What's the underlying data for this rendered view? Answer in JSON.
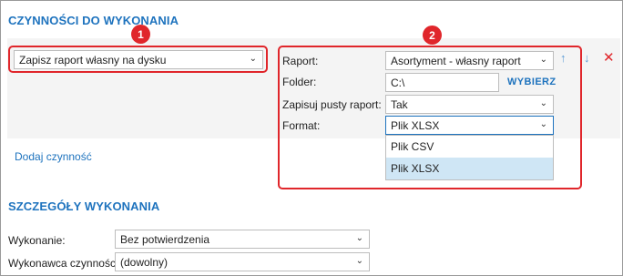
{
  "sections": {
    "actions_heading": "CZYNNOŚCI DO WYKONANIA",
    "details_heading": "SZCZEGÓŁY WYKONANIA"
  },
  "badges": [
    "1",
    "2"
  ],
  "action": {
    "selected": "Zapisz raport własny na dysku",
    "add_link": "Dodaj czynność"
  },
  "params": {
    "report_label": "Raport:",
    "report_value": "Asortyment - własny raport",
    "folder_label": "Folder:",
    "folder_value": "C:\\",
    "choose_label": "WYBIERZ",
    "empty_label": "Zapisuj pusty raport:",
    "empty_value": "Tak",
    "format_label": "Format:",
    "format_value": "Plik XLSX",
    "format_options": [
      "Plik CSV",
      "Plik XLSX"
    ]
  },
  "details": {
    "execution_label": "Wykonanie:",
    "execution_value": "Bez potwierdzenia",
    "executor_label": "Wykonawca czynności:",
    "executor_value": "(dowolny)"
  },
  "colors": {
    "accent": "#1e73be",
    "highlight": "#e0262b",
    "selected_option": "#cfe6f5"
  }
}
